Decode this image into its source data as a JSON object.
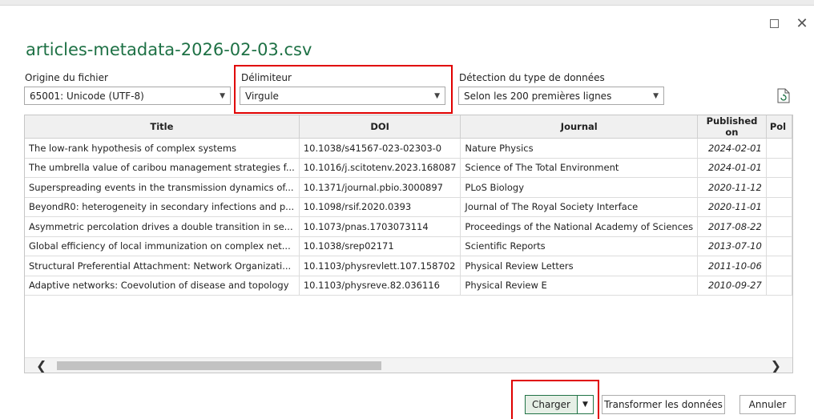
{
  "dialog": {
    "title": "articles-metadata-2026-02-03.csv"
  },
  "fields": {
    "origin": {
      "label": "Origine du fichier",
      "value": "65001: Unicode (UTF-8)"
    },
    "delimiter": {
      "label": "Délimiteur",
      "value": "Virgule"
    },
    "detection": {
      "label": "Détection du type de données",
      "value": "Selon les 200 premières lignes"
    }
  },
  "table": {
    "headers": [
      "Title",
      "DOI",
      "Journal",
      "Published on",
      "Pol"
    ],
    "rows": [
      [
        "The low-rank hypothesis of complex systems",
        "10.1038/s41567-023-02303-0",
        "Nature Physics",
        "2024-02-01"
      ],
      [
        "The umbrella value of caribou management strategies f...",
        "10.1016/j.scitotenv.2023.168087",
        "Science of The Total Environment",
        "2024-01-01"
      ],
      [
        "Superspreading events in the transmission dynamics of...",
        "10.1371/journal.pbio.3000897",
        "PLoS Biology",
        "2020-11-12"
      ],
      [
        "BeyondR0: heterogeneity in secondary infections and p...",
        "10.1098/rsif.2020.0393",
        "Journal of The Royal Society Interface",
        "2020-11-01"
      ],
      [
        "Asymmetric percolation drives a double transition in se...",
        "10.1073/pnas.1703073114",
        "Proceedings of the National Academy of Sciences",
        "2017-08-22"
      ],
      [
        "Global efficiency of local immunization on complex net...",
        "10.1038/srep02171",
        "Scientific Reports",
        "2013-07-10"
      ],
      [
        "Structural Preferential Attachment: Network Organizati...",
        "10.1103/physrevlett.107.158702",
        "Physical Review Letters",
        "2011-10-06"
      ],
      [
        "Adaptive networks: Coevolution of disease and topology",
        "10.1103/physreve.82.036116",
        "Physical Review E",
        "2010-09-27"
      ]
    ]
  },
  "buttons": {
    "load": "Charger",
    "transform": "Transformer les données",
    "cancel": "Annuler"
  },
  "colors": {
    "title": "#1e7145",
    "highlight": "#e00000",
    "load_border": "#217346"
  }
}
